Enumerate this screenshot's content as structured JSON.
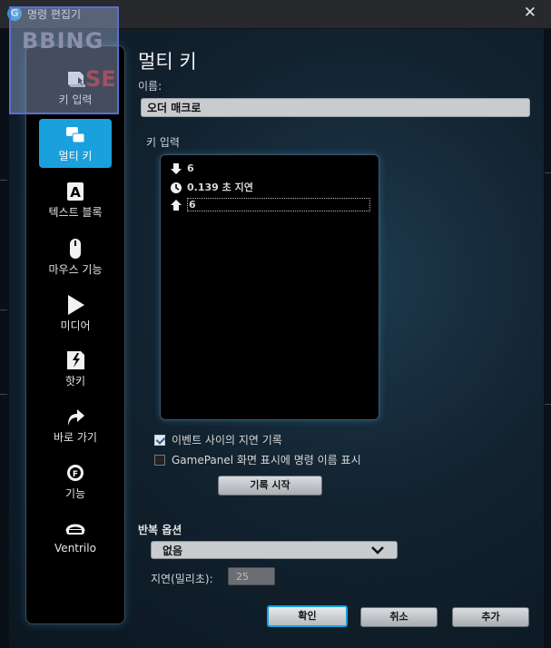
{
  "window": {
    "title": "명령 편집기",
    "close_glyph": "✕"
  },
  "watermark": {
    "line1": "BBING",
    "line2": "SE"
  },
  "sidebar": {
    "items": [
      {
        "label": "키 입력",
        "icon": "keycap-icon",
        "active": false
      },
      {
        "label": "멀티 키",
        "icon": "multi-key-icon",
        "active": true
      },
      {
        "label": "텍스트 블록",
        "icon": "text-block-icon",
        "active": false
      },
      {
        "label": "마우스 기능",
        "icon": "mouse-icon",
        "active": false
      },
      {
        "label": "미디어",
        "icon": "play-icon",
        "active": false
      },
      {
        "label": "핫키",
        "icon": "hotkey-icon",
        "active": false
      },
      {
        "label": "바로 가기",
        "icon": "shortcut-arrow-icon",
        "active": false
      },
      {
        "label": "기능",
        "icon": "function-gear-icon",
        "active": false
      },
      {
        "label": "Ventrilo",
        "icon": "headset-icon",
        "active": false
      }
    ]
  },
  "editor": {
    "heading": "멀티 키",
    "name_label": "이름:",
    "name_value": "오더 매크로",
    "key_input_label": "키 입력",
    "events": [
      {
        "icon": "down-arrow-icon",
        "text": "6"
      },
      {
        "icon": "clock-icon",
        "text": "0.139 초 지연"
      },
      {
        "icon": "up-arrow-icon",
        "text": "6"
      }
    ],
    "record_delay_label": "이벤트 사이의 지연 기록",
    "record_delay_checked": true,
    "gamepanel_label": "GamePanel 화면 표시에 명령 이름 표시",
    "gamepanel_checked": false,
    "start_record_label": "기록 시작",
    "repeat_label": "반복 옵션",
    "repeat_value": "없음",
    "delay_label": "지연(밀리초):",
    "delay_value": "25"
  },
  "footer": {
    "ok_label": "확인",
    "cancel_label": "취소",
    "add_label": "추가"
  },
  "colors": {
    "accent": "#1aa0dc",
    "background": "#12222f"
  }
}
